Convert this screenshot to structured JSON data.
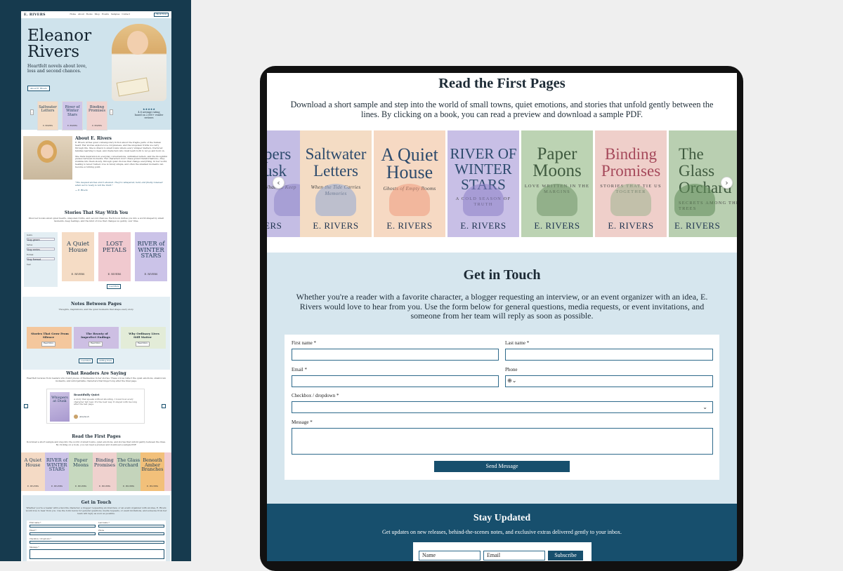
{
  "site": {
    "brand": "E. RIVERS",
    "nav": [
      "Home",
      "About",
      "Books",
      "Shop",
      "Events",
      "Samples",
      "Contact"
    ],
    "nav_button": "Book Now"
  },
  "hero": {
    "name": "Eleanor Rivers",
    "tagline": "Heartfelt novels about love, loss and second chances.",
    "cta": "About E. Rivers",
    "stars": "★★★★★",
    "rating": "4.8 average rating",
    "rating_sub": "based on 2,000+ reader reviews",
    "covers": [
      {
        "title": "Saltwater Letters",
        "author": "E. RIVERS",
        "color": "#f2dcc6"
      },
      {
        "title": "River of Winter Stars",
        "author": "E. RIVERS",
        "color": "#cfc6e8"
      },
      {
        "title": "Binding Promises",
        "author": "E. RIVERS",
        "color": "#f0d3cf"
      }
    ]
  },
  "about": {
    "title": "About E. Rivers",
    "para1": "E. Rivers writes quiet contemporary fiction about the fragile parts of the human heart. Her stories explore love, forgiveness, and the unspoken truths we carry through life. She is drawn to small towns where every whisper matters, fractured families learning to heal, and characters who must learn both to let go and hold on.",
    "para2": "She finds inspiration in everyday conversations, unfinished letters, and the thoughtful pauses between moments. Her characters don't chase grand transformations—they stumble into them slowly, through quiet choices that change everything. In her world, healing is never rushed, love is rarely simple, and often the smallest moments can become a turning point.",
    "quote": "\"The deepest stories aren't shouted. They're whispered, held, and finally released when we're ready to tell the truth.\"",
    "quote_by": "— E. Rivers"
  },
  "stories": {
    "title": "Stories That Stay With You",
    "sub": "Discover novels about quiet hearts, unspoken truths, and second chances. Each book invites you into a world shaped by small moments, deep feelings, and the kind of love that changes us gently, over time.",
    "filters": [
      "Genre",
      "Series",
      "Format",
      "Year"
    ],
    "filter_values": [
      "Any genre",
      "Any series",
      "Any format"
    ],
    "books": [
      {
        "title": "A Quiet House",
        "author": "E. RIVERS",
        "color": "#f5dcc5"
      },
      {
        "title": "LOST PETALS",
        "author": "E. RIVERS",
        "color": "#f0c9cf"
      },
      {
        "title": "RIVER of WINTER STARS",
        "author": "E. RIVERS",
        "color": "#cbc3e8"
      }
    ],
    "load": "Load More"
  },
  "notes": {
    "title": "Notes Between Pages",
    "sub": "Thoughts, inspirations, and the quiet moments that shape every story.",
    "cards": [
      {
        "title": "Stories That Grow From Silence",
        "color": "#f4c79d",
        "button": "Read More"
      },
      {
        "title": "The Beauty of Imperfect Endings",
        "color": "#cdbfe3",
        "button": "Read More"
      },
      {
        "title": "Why Ordinary Lives Still Matter",
        "color": "#e3ecd8",
        "button": "Read More"
      }
    ],
    "btn1": "Load More",
    "btn2": "All Blog Posts"
  },
  "readers": {
    "title": "What Readers Are Saying",
    "sub": "Heartfelt reviews from readers who found pieces of themselves in her stories. These voices reflect the quiet emotions, small-town moments, and unforgettable characters that linger long after the final page.",
    "book": "Whispers at Dusk",
    "book_author": "E. RIVERS",
    "review_title": "Beautifully Quiet",
    "review_text": "A story that speaks without shouting. I loved how every character felt real. It's the best way. It stayed with me long after the last page.",
    "reviewer": "Amelie K."
  },
  "first_pages_small": {
    "title": "Read the First Pages",
    "sub": "Download a short sample and step into the world of small towns, quiet emotions, and stories that unfold gently between the lines. By clicking on a book, you can read a preview and download a sample PDF.",
    "books": [
      {
        "title": "A Quiet House",
        "color": "#f4dac5"
      },
      {
        "title": "RIVER of WINTER STARS",
        "color": "#cdc4e8"
      },
      {
        "title": "Paper Moons",
        "color": "#c7d9bf"
      },
      {
        "title": "Binding Promises",
        "color": "#efd1ce"
      },
      {
        "title": "The Glass Orchard",
        "color": "#c4d4bb"
      },
      {
        "title": "Beneath Amber Branches",
        "color": "#f2c07a"
      },
      {
        "title": "E.",
        "color": "#f0cbd0"
      }
    ],
    "author": "E. RIVERS"
  },
  "get_in_touch_small": {
    "title": "Get in Touch",
    "sub": "Whether you're a reader with a favorite character, a blogger requesting an interview, or an event organizer with an idea, E. Rivers would love to hear from you. Use the form below for general questions, media requests, or event invitations, and someone from her team will reply as soon as possible."
  },
  "tablet": {
    "read": {
      "title": "Read the First Pages",
      "sub": "Download a short sample and step into the world of small towns, quiet emotions, and stories that unfold gently between the lines. By clicking on a book, you can read a preview and download a sample PDF.",
      "books": [
        {
          "title": "Whispers at Dusk",
          "line1": "pers",
          "line2": "usk",
          "sub": "What We Keep",
          "author": "ERS",
          "color": "#c4bde4"
        },
        {
          "title": "Saltwater Letters",
          "sub": "When the Tide Carries Memories",
          "author": "E. RIVERS",
          "color": "#f4dcc4"
        },
        {
          "title": "A Quiet House",
          "sub": "Ghosts of Empty Rooms",
          "author": "E. RIVERS",
          "color": "#f6d9c3"
        },
        {
          "title": "RIVER OF WINTER STARS",
          "sub": "A COLD SEASON OF TRUTH",
          "author": "E. RIVERS",
          "color": "#c8bfe6"
        },
        {
          "title": "Paper Moons",
          "sub": "LOVE WRITTEN IN THE MARGINS",
          "author": "E. RIVERS",
          "color": "#bcd3b3"
        },
        {
          "title": "Binding Promises",
          "sub": "STORIES THAT TIE US TOGETHER",
          "author": "E. RIVERS",
          "color": "#efcfca"
        },
        {
          "title": "The Glass Orchard",
          "sub": "SECRETS AMONG THE TREES",
          "author": "E. RIVERS",
          "color": "#b9cfb1"
        }
      ]
    },
    "touch": {
      "title": "Get in Touch",
      "sub": "Whether you're a reader with a favorite character, a blogger requesting an interview, or an event organizer with an idea, E. Rivers would love to hear from you. Use the form below for general questions, media requests, or event invitations, and someone from her team will reply as soon as possible.",
      "first_name": "First name *",
      "last_name": "Last name *",
      "email": "Email *",
      "phone": "Phone",
      "dropdown": "Checkbox / dropdown *",
      "message": "Message *",
      "send": "Send Message"
    },
    "stay": {
      "title": "Stay Updated",
      "sub": "Get updates on new releases, behind-the-scenes notes, and exclusive extras delivered gently to your inbox.",
      "name_ph": "Name",
      "email_ph": "Email",
      "subscribe": "Subscribe"
    }
  },
  "colors": {
    "accent": "#174f6d",
    "dark_bg": "#163a4e",
    "hero_bg": "#cfe3ec"
  }
}
